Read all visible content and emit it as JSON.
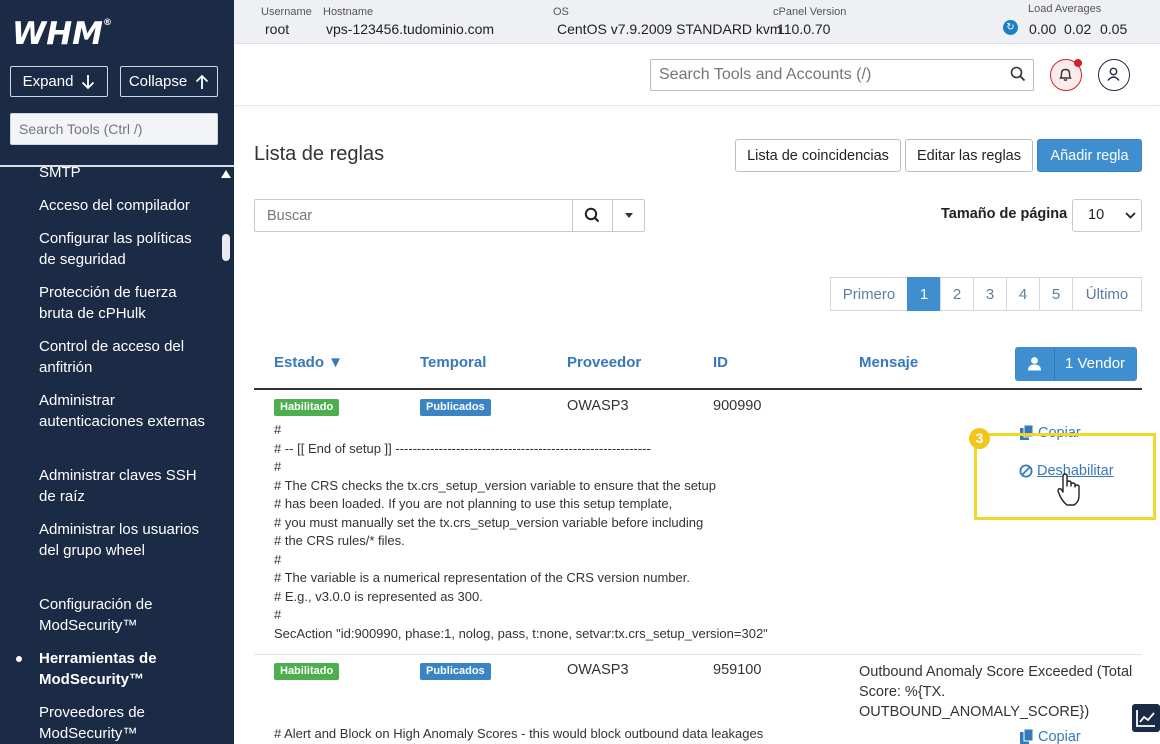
{
  "sidebar": {
    "logo": "WHM",
    "expand_label": "Expand",
    "collapse_label": "Collapse",
    "search_placeholder": "Search Tools (Ctrl /)",
    "items": [
      {
        "label": "SMTP"
      },
      {
        "label": "Acceso del compilador"
      },
      {
        "label": "Configurar las políticas de seguridad"
      },
      {
        "label": "Protección de fuerza bruta de cPHulk"
      },
      {
        "label": "Control de acceso del anfitrión"
      },
      {
        "label": "Administrar autenticaciones externas"
      },
      {
        "label": "Administrar claves SSH de raíz"
      },
      {
        "label": "Administrar los usuarios del grupo wheel"
      },
      {
        "label": "Configuración de ModSecurity™"
      },
      {
        "label": "Herramientas de ModSecurity™",
        "active": true
      },
      {
        "label": "Proveedores de ModSecurity™"
      }
    ]
  },
  "infobar": {
    "username_label": "Username",
    "username": "root",
    "hostname_label": "Hostname",
    "hostname": "vps-123456.tudominio.com",
    "os_label": "OS",
    "os": "CentOS v7.9.2009 STANDARD kvm",
    "cpanel_label": "cPanel Version",
    "cpanel_version": "110.0.70",
    "load_label": "Load Averages",
    "load": [
      "0.00",
      "0.02",
      "0.05"
    ]
  },
  "header": {
    "search_placeholder": "Search Tools and Accounts (/)"
  },
  "main": {
    "title": "Lista de reglas",
    "buttons": {
      "matches": "Lista de coincidencias",
      "edit": "Editar las reglas",
      "add": "Añadir regla"
    },
    "search_placeholder": "Buscar",
    "page_size_label": "Tamaño de página",
    "page_size": "10",
    "pagination": {
      "first": "Primero",
      "pages": [
        "1",
        "2",
        "3",
        "4",
        "5"
      ],
      "current": "1",
      "last": "Último"
    },
    "columns": {
      "status": "Estado ▼",
      "temporal": "Temporal",
      "vendor": "Proveedor",
      "id": "ID",
      "message": "Mensaje"
    },
    "vendor_button": "1 Vendor",
    "rows": [
      {
        "status": "Habilitado",
        "temporal": "Publicados",
        "vendor": "OWASP3",
        "id": "900990",
        "message": "",
        "code": "#\n# -- [[ End of setup ]] -----------------------------------------------------------\n#\n# The CRS checks the tx.crs_setup_version variable to ensure that the setup\n# has been loaded. If you are not planning to use this setup template,\n# you must manually set the tx.crs_setup_version variable before including\n# the CRS rules/* files.\n#\n# The variable is a numerical representation of the CRS version number.\n# E.g., v3.0.0 is represented as 300.\n#\nSecAction \"id:900990, phase:1, nolog, pass, t:none, setvar:tx.crs_setup_version=302\"",
        "actions": {
          "copy": "Copiar",
          "disable": "Deshabilitar"
        }
      },
      {
        "status": "Habilitado",
        "temporal": "Publicados",
        "vendor": "OWASP3",
        "id": "959100",
        "message": "Outbound Anomaly Score Exceeded (Total Score: %{TX. OUTBOUND_ANOMALY_SCORE})",
        "code": "# Alert and Block on High Anomaly Scores - this would block outbound data leakages",
        "actions": {
          "copy": "Copiar"
        }
      }
    ],
    "step_number": "3"
  },
  "colors": {
    "sidebar_bg": "#1c2b45",
    "accent": "#3e8ed0",
    "link": "#3579b8",
    "badge_green": "#4cae4c",
    "badge_blue": "#3a84c4",
    "highlight": "#f0d728"
  }
}
